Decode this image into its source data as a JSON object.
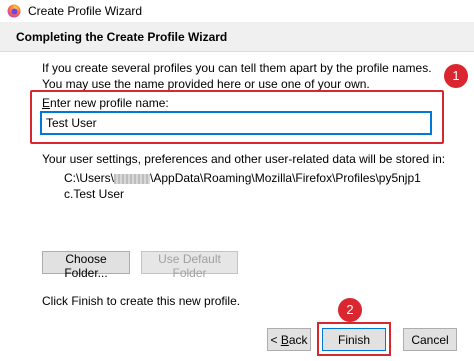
{
  "window": {
    "title": "Create Profile Wizard",
    "icon": "firefox-icon"
  },
  "header": {
    "title": "Completing the Create Profile Wizard"
  },
  "intro_text": "If you create several profiles you can tell them apart by the profile names. You may use the name provided here or use one of your own.",
  "name_field": {
    "label_prefix": "",
    "label_mnemonic": "E",
    "label_rest": "nter new profile name:",
    "value": "Test User"
  },
  "storage": {
    "label": "Your user settings, preferences and other user-related data will be stored in:",
    "path_before_mask": "C:\\Users\\",
    "path_after_mask": "\\AppData\\Roaming\\Mozilla\\Firefox\\Profiles\\py5njp1c.Test User"
  },
  "buttons": {
    "choose_folder": "Choose Folder...",
    "use_default_folder": "Use Default Folder",
    "back_mnemonic": "B",
    "back_rest": "ack",
    "back_prefix": "< ",
    "finish": "Finish",
    "cancel": "Cancel"
  },
  "finish_instruction": "Click Finish to create this new profile.",
  "annotations": {
    "callout_1": "1",
    "callout_2": "2",
    "highlight_color": "#d9262f"
  },
  "colors": {
    "focus_border": "#0078d7",
    "header_band": "#f0f0f0"
  }
}
